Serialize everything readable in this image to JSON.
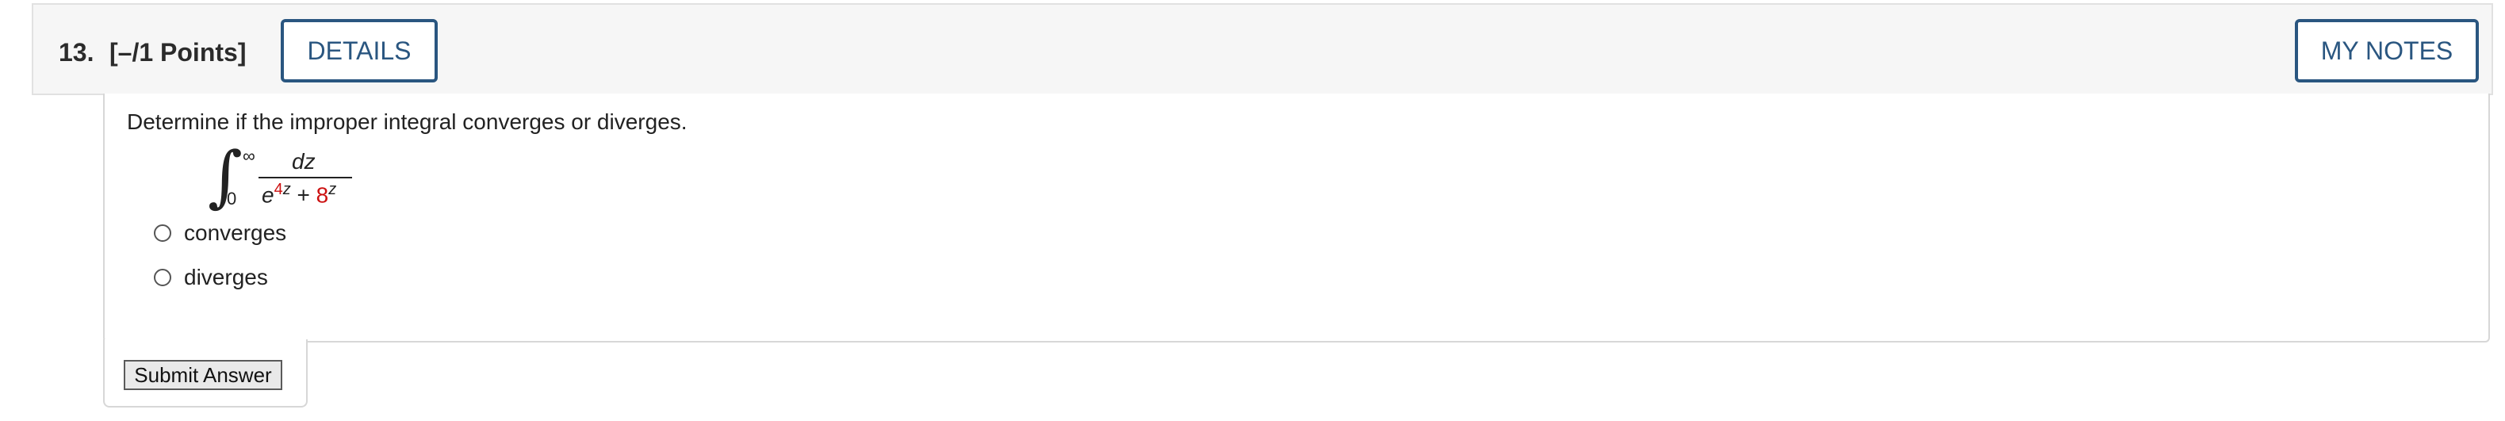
{
  "header": {
    "question_number": "13.",
    "points": "[–/1 Points]",
    "details_label": "DETAILS",
    "my_notes_label": "MY NOTES"
  },
  "question": {
    "prompt": "Determine if the improper integral converges or diverges.",
    "integral": {
      "lower_limit": "0",
      "upper_limit": "∞",
      "numerator": "dz",
      "denominator": {
        "term1_base": "e",
        "term1_exponent_coef": "4",
        "term1_exponent_var": "z",
        "operator": "+",
        "term2_base": "8",
        "term2_exponent": "z"
      }
    },
    "options": [
      {
        "label": "converges"
      },
      {
        "label": "diverges"
      }
    ]
  },
  "submit_label": "Submit Answer",
  "colors": {
    "accent": "#2a5680",
    "highlight_red": "#cc1111",
    "header_bg": "#f6f6f6"
  }
}
